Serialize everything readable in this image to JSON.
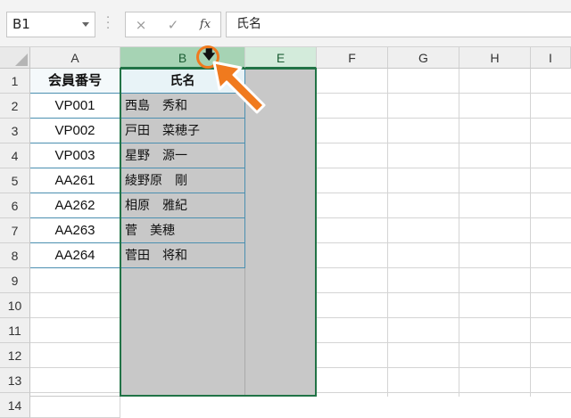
{
  "formula_bar": {
    "name_box": "B1",
    "cancel_icon": "×",
    "enter_icon": "✓",
    "fx_label": "fx",
    "content": "氏名"
  },
  "columns": [
    "A",
    "B",
    "E",
    "F",
    "G",
    "H",
    "I"
  ],
  "rows": [
    "1",
    "2",
    "3",
    "4",
    "5",
    "6",
    "7",
    "8",
    "9",
    "10",
    "11",
    "12",
    "13",
    "14"
  ],
  "table": {
    "header_code": "会員番号",
    "header_name": "氏名",
    "codes": [
      "VP001",
      "VP002",
      "VP003",
      "AA261",
      "AA262",
      "AA263",
      "AA264"
    ],
    "names": [
      "西島　秀和",
      "戸田　菜穂子",
      "星野　源一",
      "綾野原　剛",
      "相原　雅紀",
      "菅　美穂",
      "菅田　将和"
    ]
  },
  "annotation": {
    "cursor_glyph": "🡇",
    "arrow_color": "#f07a1e",
    "selection_color": "#217346"
  }
}
